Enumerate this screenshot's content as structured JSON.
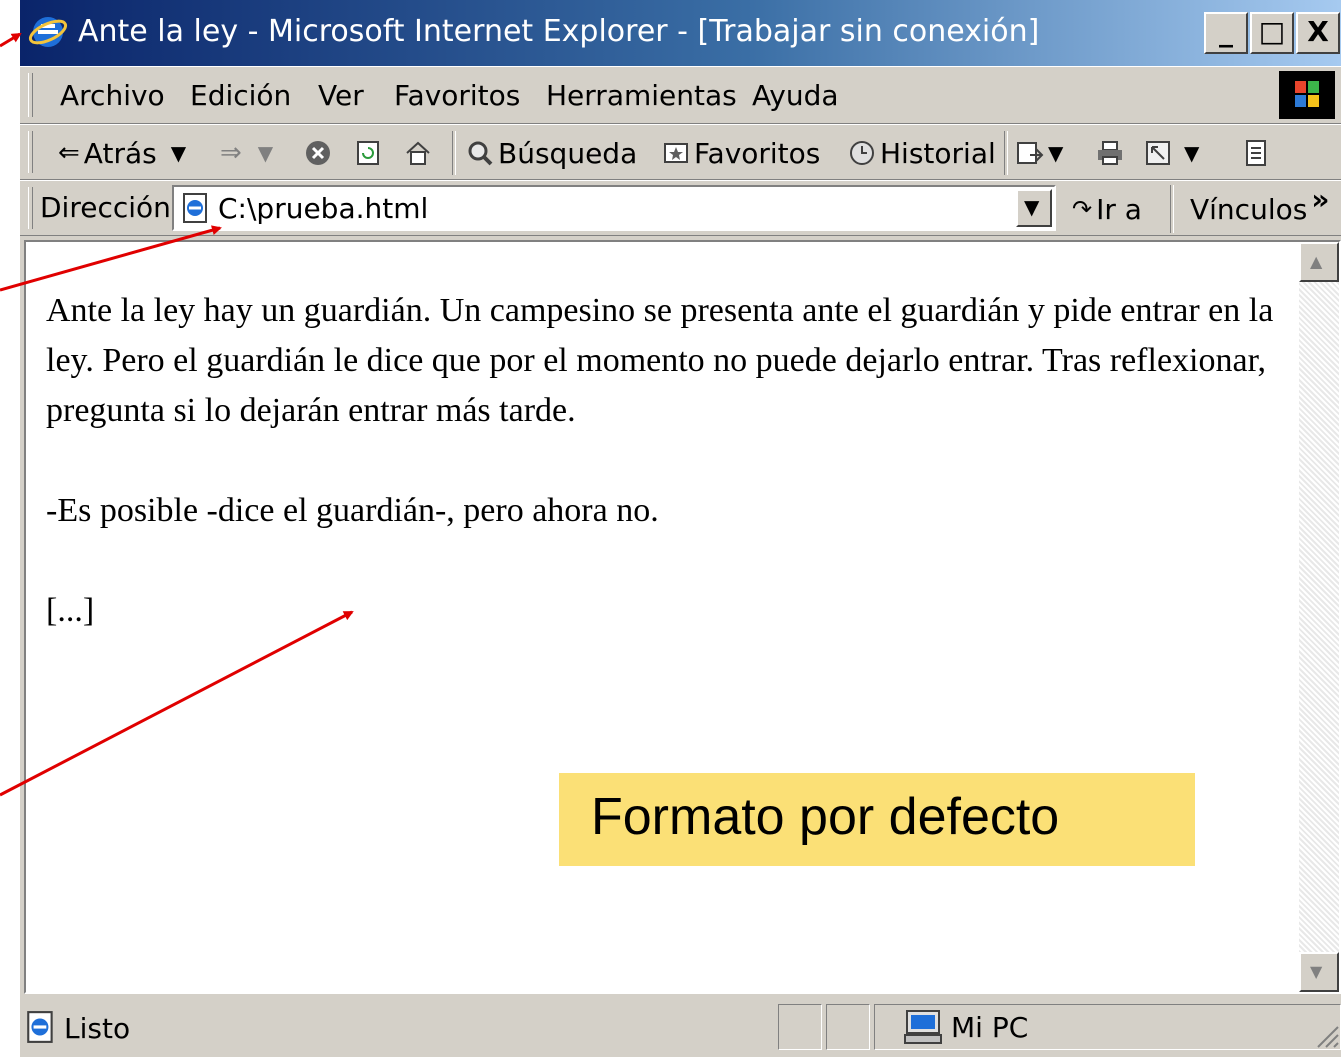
{
  "window": {
    "title": "Ante la ley - Microsoft Internet Explorer - [Trabajar sin conexión]",
    "controls": {
      "minimize": "_",
      "maximize": "□",
      "close": "X"
    }
  },
  "menu": {
    "items": [
      "Archivo",
      "Edición",
      "Ver",
      "Favoritos",
      "Herramientas",
      "Ayuda"
    ]
  },
  "toolbar": {
    "back_label": "Atrás",
    "search_label": "Búsqueda",
    "favorites_label": "Favoritos",
    "history_label": "Historial"
  },
  "address_bar": {
    "label": "Dirección",
    "value": "C:\\prueba.html",
    "go_label": "Ir a",
    "links_label": "Vínculos",
    "more_glyph": "»"
  },
  "page": {
    "paragraphs": [
      "Ante la ley hay un guardián. Un campesino se presenta ante el guardián y pide entrar en la ley. Pero el guardián le dice que por el momento no puede dejarlo entrar. Tras reflexionar, pregunta si lo dejarán entrar más tarde.",
      "-Es posible -dice el guardián-, pero ahora no.",
      "[...]"
    ]
  },
  "status_bar": {
    "status": "Listo",
    "zone": "Mi PC"
  },
  "annotation": {
    "callout_text": "Formato por defecto",
    "callout_color": "#fbe076",
    "arrow_color": "#e00000"
  },
  "colors": {
    "titlebar_start": "#0a246a",
    "titlebar_end": "#a6caf0",
    "chrome": "#d4d0c8"
  }
}
